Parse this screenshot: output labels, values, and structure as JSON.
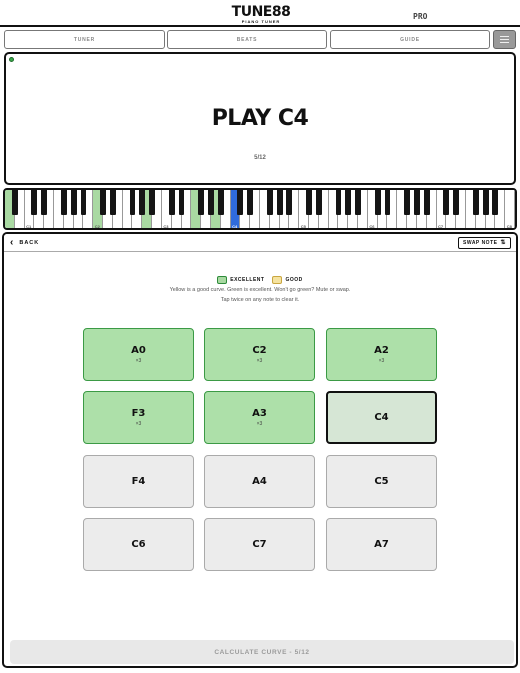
{
  "brand": {
    "name": "TUNE88",
    "tagline": "PIANO TUNER",
    "pro_badge": "PRO"
  },
  "tabs": [
    {
      "label": "TUNER"
    },
    {
      "label": "BEATS"
    },
    {
      "label": "GUIDE"
    }
  ],
  "prompt": {
    "title": "PLAY C4",
    "progress": "5/12"
  },
  "piano": {
    "octave_labels": [
      "C1",
      "C2",
      "C3",
      "C4",
      "C5",
      "C6",
      "C7",
      "C8"
    ],
    "current_key": "C4",
    "colors": {
      "excellent": "#a9d9a2",
      "current": "#2f6bdc"
    }
  },
  "controls": {
    "back_label": "BACK",
    "swap_label": "SWAP NOTE"
  },
  "legend": {
    "excellent": "EXCELLENT",
    "good": "GOOD"
  },
  "help": {
    "line1": "Yellow is a good curve. Green is excellent. Won't go green? Mute or swap.",
    "line2": "Tap twice on any note to clear it."
  },
  "notes": [
    {
      "name": "A0",
      "count": "×3",
      "status": "excellent"
    },
    {
      "name": "C2",
      "count": "×3",
      "status": "excellent"
    },
    {
      "name": "A2",
      "count": "×3",
      "status": "excellent"
    },
    {
      "name": "F3",
      "count": "×3",
      "status": "excellent"
    },
    {
      "name": "A3",
      "count": "×3",
      "status": "excellent"
    },
    {
      "name": "C4",
      "count": "",
      "status": "current"
    },
    {
      "name": "F4",
      "count": "",
      "status": "pending"
    },
    {
      "name": "A4",
      "count": "",
      "status": "pending"
    },
    {
      "name": "C5",
      "count": "",
      "status": "pending"
    },
    {
      "name": "C6",
      "count": "",
      "status": "pending"
    },
    {
      "name": "C7",
      "count": "",
      "status": "pending"
    },
    {
      "name": "A7",
      "count": "",
      "status": "pending"
    }
  ],
  "calculate_button": {
    "label": "CALCULATE CURVE - 5/12"
  }
}
